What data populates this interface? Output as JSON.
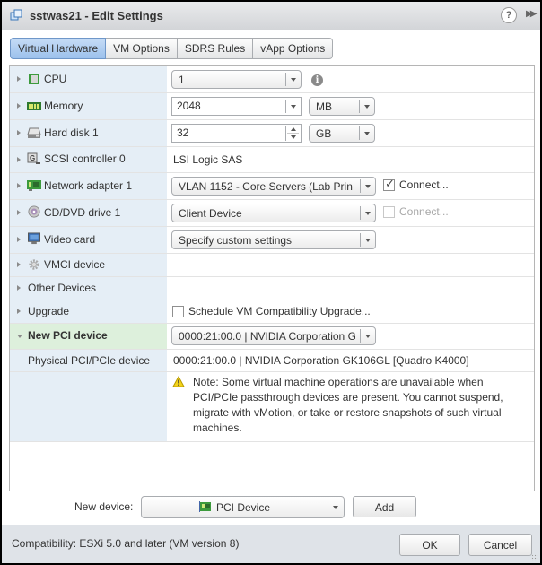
{
  "window": {
    "title": "sstwas21 - Edit Settings",
    "help_label": "?",
    "expand_label": "▶▶"
  },
  "tabs": [
    {
      "label": "Virtual Hardware",
      "active": true
    },
    {
      "label": "VM Options",
      "active": false
    },
    {
      "label": "SDRS Rules",
      "active": false
    },
    {
      "label": "vApp Options",
      "active": false
    }
  ],
  "hardware": {
    "cpu": {
      "label": "CPU",
      "value": "1",
      "info": "i"
    },
    "memory": {
      "label": "Memory",
      "value": "2048",
      "unit": "MB"
    },
    "hard_disk": {
      "label": "Hard disk 1",
      "value": "32",
      "unit": "GB"
    },
    "scsi": {
      "label": "SCSI controller 0",
      "value": "LSI Logic SAS"
    },
    "network": {
      "label": "Network adapter 1",
      "value": "VLAN 1152 - Core Servers (Lab Prin",
      "connect_label": "Connect...",
      "connected": true
    },
    "cddvd": {
      "label": "CD/DVD drive 1",
      "value": "Client Device",
      "connect_label": "Connect...",
      "connected": false
    },
    "video": {
      "label": "Video card",
      "value": "Specify custom settings"
    },
    "vmci": {
      "label": "VMCI device"
    },
    "other": {
      "label": "Other Devices"
    },
    "upgrade": {
      "label": "Upgrade",
      "checkbox_label": "Schedule VM Compatibility Upgrade...",
      "checked": false
    },
    "new_pci": {
      "label": "New PCI device",
      "value": "0000:21:00.0 | NVIDIA Corporation G",
      "physical_label": "Physical PCI/PCIe device",
      "physical_value": "0000:21:00.0 | NVIDIA Corporation GK106GL [Quadro K4000]",
      "note": "Note: Some virtual machine operations are unavailable when PCI/PCIe passthrough devices are present. You cannot suspend, migrate with vMotion, or take or restore snapshots of such virtual machines."
    }
  },
  "new_device": {
    "label": "New device:",
    "value": "PCI Device",
    "add_label": "Add"
  },
  "footer": {
    "compatibility": "Compatibility: ESXi 5.0 and later (VM version 8)",
    "ok_label": "OK",
    "cancel_label": "Cancel"
  },
  "colors": {
    "selected_tab": "#9cc1ec",
    "label_column": "#e5eef6",
    "selected_row": "#ddf0dc",
    "footer_bg": "#dfe3e8"
  }
}
